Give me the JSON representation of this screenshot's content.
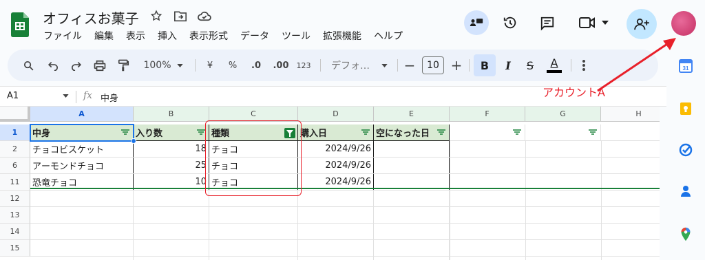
{
  "app": {
    "title": "オフィスお菓子",
    "menu": [
      "ファイル",
      "編集",
      "表示",
      "挿入",
      "表示形式",
      "データ",
      "ツール",
      "拡張機能",
      "ヘルプ"
    ]
  },
  "toolbar": {
    "zoom": "100%",
    "currency": "¥",
    "percent": "%",
    "dec_minus": ".0",
    "dec_plus": ".00",
    "format123": "123",
    "font": "デフォ…",
    "font_size": "10",
    "bold": "B",
    "italic": "I",
    "strike": "S",
    "textcolor": "A"
  },
  "formula": {
    "cell_ref": "A1",
    "fx": "fx",
    "content": "中身"
  },
  "columns": [
    "A",
    "B",
    "C",
    "D",
    "E",
    "F",
    "G",
    "H"
  ],
  "rows": [
    "1",
    "2",
    "6",
    "11",
    "12",
    "13",
    "14",
    "15"
  ],
  "table": {
    "headers": [
      "中身",
      "入り数",
      "種類",
      "購入日",
      "空になった日"
    ],
    "data": [
      [
        "チョコビスケット",
        "18",
        "チョコ",
        "2024/9/26",
        ""
      ],
      [
        "アーモンドチョコ",
        "25",
        "チョコ",
        "2024/9/26",
        ""
      ],
      [
        "恐竜チョコ",
        "10",
        "チョコ",
        "2024/9/26",
        ""
      ]
    ]
  },
  "annotation": {
    "label": "アカウントA",
    "color": "#e8202a"
  },
  "colors": {
    "sheets_green": "#188038",
    "header_green": "#d9ead3",
    "toolbar_bg": "#edf2fa",
    "avatar": "#d63a74",
    "annot_red": "#e8202a"
  },
  "icons": {
    "calendar_num": "31"
  }
}
